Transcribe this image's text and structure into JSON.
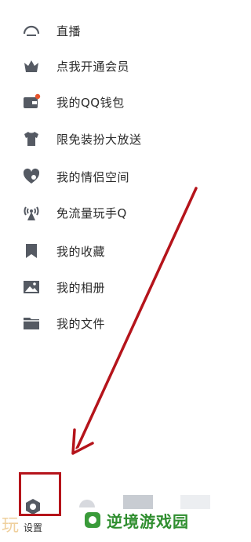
{
  "menu": {
    "items": [
      {
        "label": "直播",
        "icon": "live-icon"
      },
      {
        "label": "点我开通会员",
        "icon": "vip-crown-icon"
      },
      {
        "label": "我的QQ钱包",
        "icon": "wallet-icon"
      },
      {
        "label": "限免装扮大放送",
        "icon": "tshirt-icon"
      },
      {
        "label": "我的情侣空间",
        "icon": "couple-heart-icon"
      },
      {
        "label": "免流量玩手Q",
        "icon": "signal-tower-icon"
      },
      {
        "label": "我的收藏",
        "icon": "bookmark-icon"
      },
      {
        "label": "我的相册",
        "icon": "photo-album-icon"
      },
      {
        "label": "我的文件",
        "icon": "folder-icon"
      }
    ]
  },
  "bottom": {
    "settings_label": "设置"
  },
  "watermark": {
    "left_text": "玩",
    "site_text": "逆境游戏园"
  },
  "colors": {
    "icon_grey": "#555a63",
    "highlight_red": "#b5141b",
    "wallet_dot": "#e6542d",
    "watermark_green": "#2f8e2f"
  }
}
